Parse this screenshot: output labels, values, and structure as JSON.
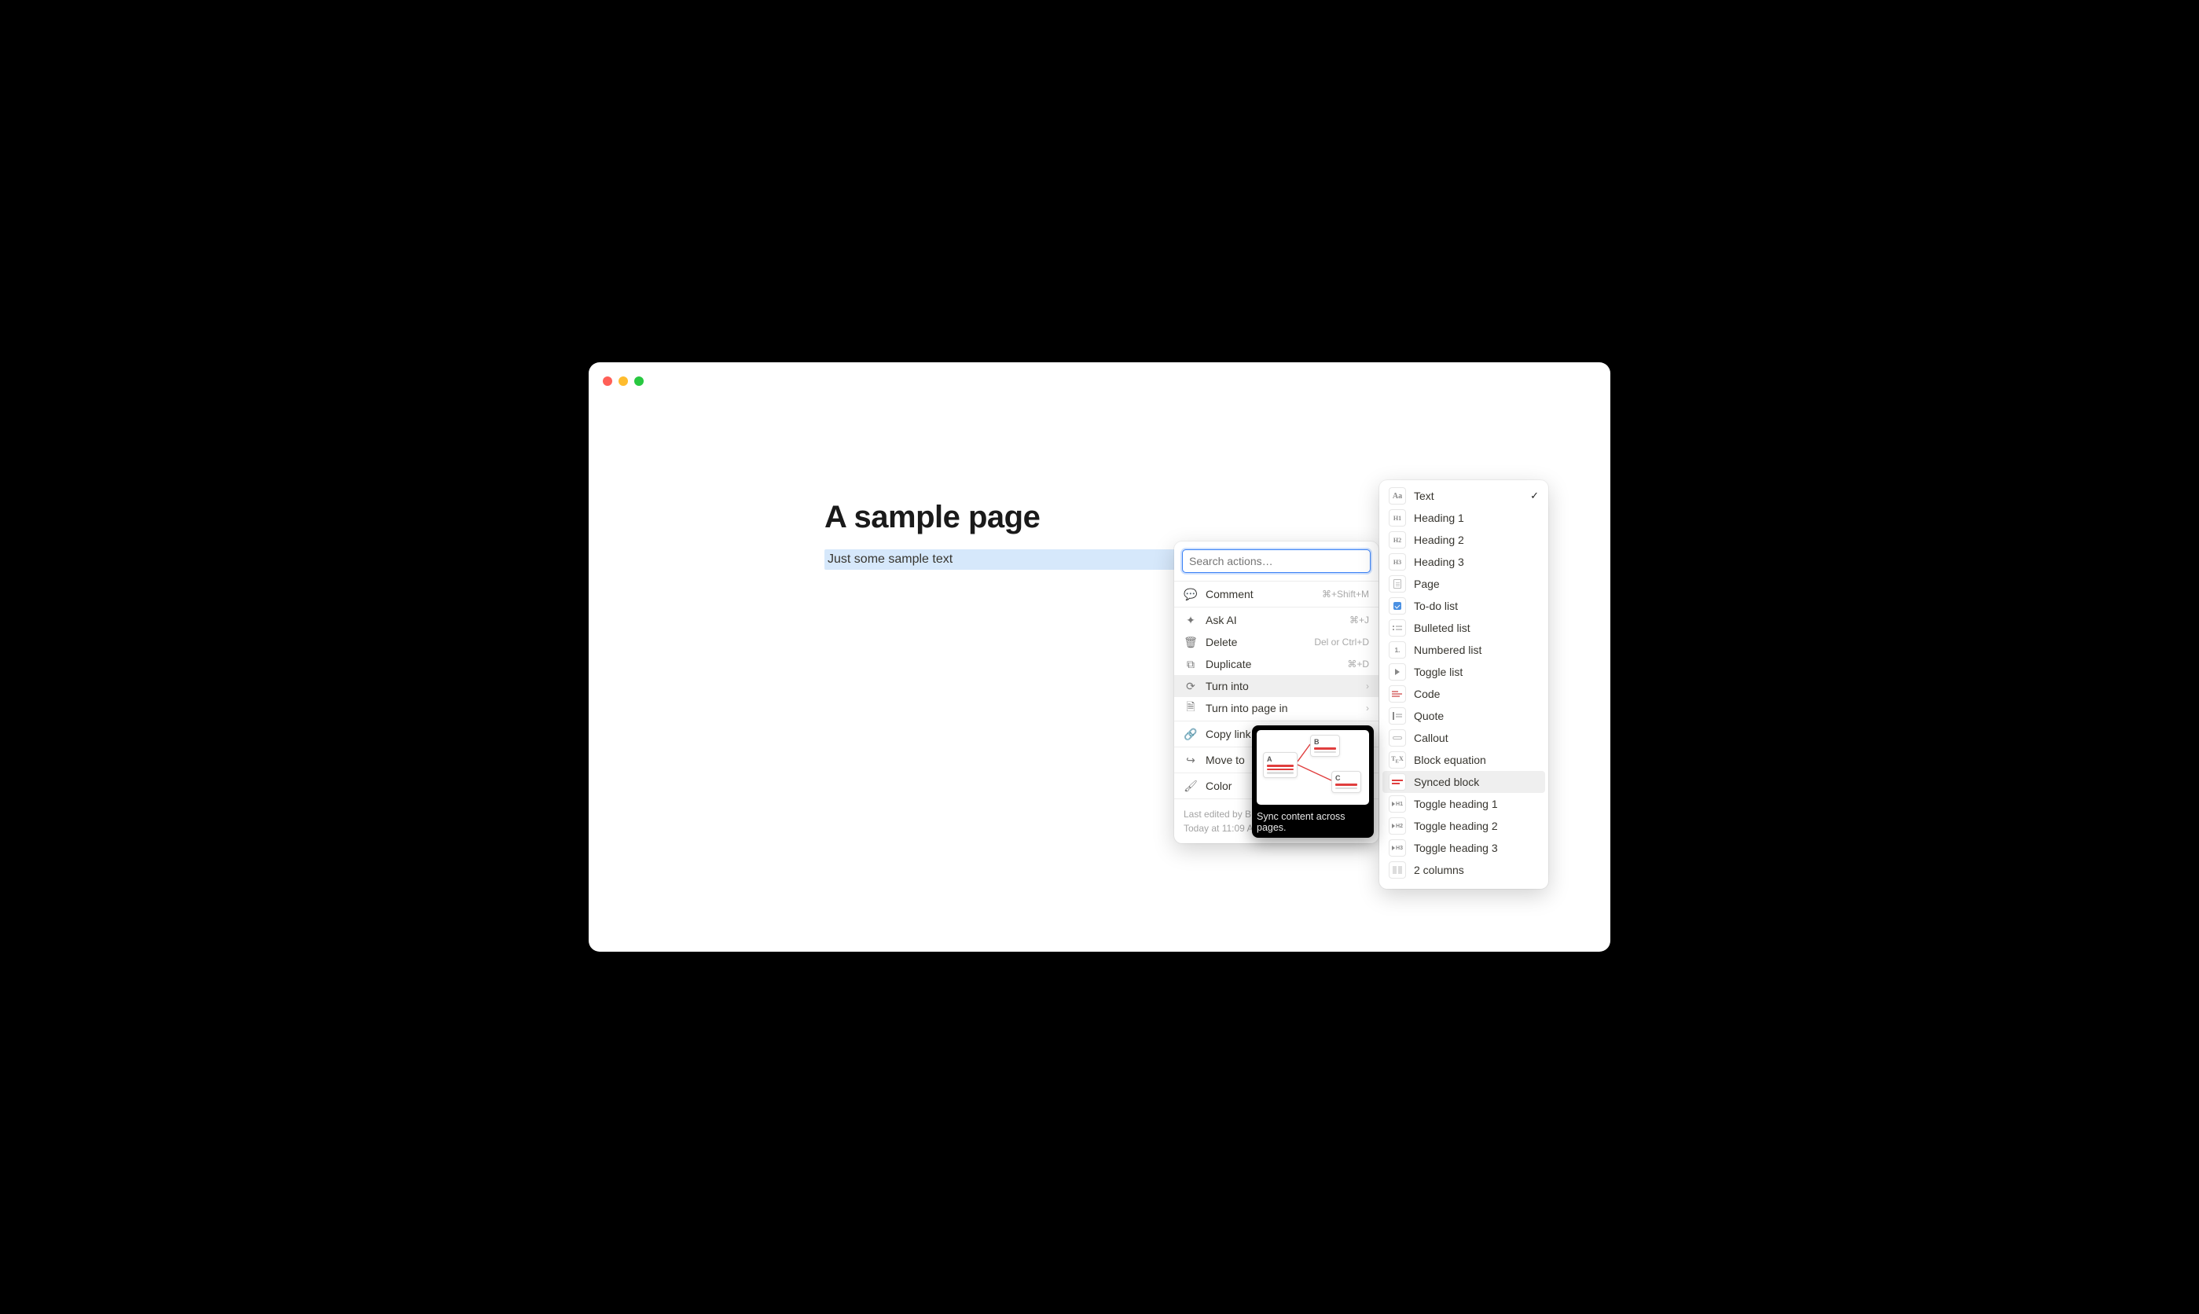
{
  "page": {
    "title": "A sample page",
    "selected_text": "Just some sample text"
  },
  "actions_menu": {
    "search_placeholder": "Search actions…",
    "items": {
      "comment": {
        "label": "Comment",
        "shortcut": "⌘+Shift+M"
      },
      "ask_ai": {
        "label": "Ask AI",
        "shortcut": "⌘+J"
      },
      "delete": {
        "label": "Delete",
        "shortcut": "Del or Ctrl+D"
      },
      "duplicate": {
        "label": "Duplicate",
        "shortcut": "⌘+D"
      },
      "turn_into": {
        "label": "Turn into"
      },
      "turn_into_page": {
        "label": "Turn into page in"
      },
      "copy_link": {
        "label": "Copy link"
      },
      "move_to": {
        "label": "Move to"
      },
      "color": {
        "label": "Color"
      }
    },
    "footer_line1": "Last edited by B",
    "footer_line2": "Today at 11:09 AM"
  },
  "tooltip": {
    "text": "Sync content across pages.",
    "preview_labels": {
      "a": "A",
      "b": "B",
      "c": "C"
    }
  },
  "turn_into_menu": {
    "selected_index": 0,
    "hovered_index": 14,
    "items": [
      {
        "label": "Text",
        "icon": "Aa"
      },
      {
        "label": "Heading 1",
        "icon": "H1"
      },
      {
        "label": "Heading 2",
        "icon": "H2"
      },
      {
        "label": "Heading 3",
        "icon": "H3"
      },
      {
        "label": "Page",
        "icon": "page"
      },
      {
        "label": "To-do list",
        "icon": "todo"
      },
      {
        "label": "Bulleted list",
        "icon": "bullet"
      },
      {
        "label": "Numbered list",
        "icon": "num"
      },
      {
        "label": "Toggle list",
        "icon": "toggle"
      },
      {
        "label": "Code",
        "icon": "code"
      },
      {
        "label": "Quote",
        "icon": "quote"
      },
      {
        "label": "Callout",
        "icon": "callout"
      },
      {
        "label": "Block equation",
        "icon": "tex"
      },
      {
        "label": "Synced block",
        "icon": "sync"
      },
      {
        "label": "Toggle heading 1",
        "icon": "th1"
      },
      {
        "label": "Toggle heading 2",
        "icon": "th2"
      },
      {
        "label": "Toggle heading 3",
        "icon": "th3"
      },
      {
        "label": "2 columns",
        "icon": "cols"
      }
    ]
  }
}
